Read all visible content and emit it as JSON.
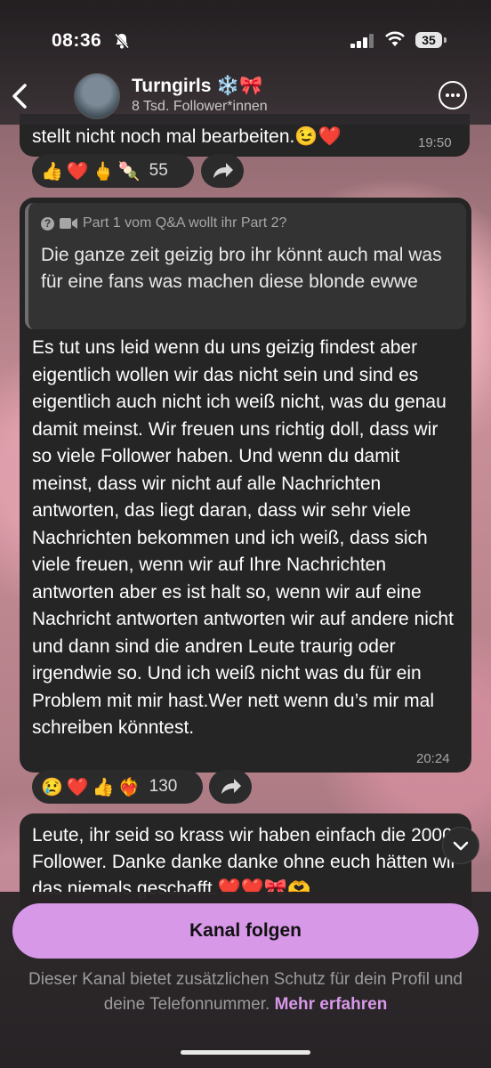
{
  "status_bar": {
    "time": "08:36",
    "battery": "35"
  },
  "header": {
    "channel_name": "Turngirls ❄️🎀",
    "followers": "8 Tsd. Follower*innen",
    "back_icon": "chevron-left-icon",
    "more_icon": "ellipsis-circle-icon"
  },
  "messages": [
    {
      "text": "stellt nicht noch mal bearbeiten.😉❤️",
      "time": "19:50",
      "reactions": [
        "👍",
        "❤️",
        "🖕",
        "🍡"
      ],
      "reaction_count": "55"
    },
    {
      "quote_header": "Part 1 vom Q&A wollt ihr Part 2?",
      "quote_text": "Die ganze zeit geizig bro ihr könnt auch mal was für eine fans was machen diese blonde ewwe",
      "text": "Es tut uns leid wenn du uns geizig findest aber eigentlich wollen wir das nicht sein und sind es eigentlich auch nicht ich weiß nicht, was du genau damit meinst. Wir freuen uns richtig doll, dass wir so viele Follower haben. Und wenn du damit meinst, dass wir nicht auf alle Nachrichten antworten, das liegt daran, dass wir sehr viele Nachrichten bekommen und ich weiß, dass sich viele freuen, wenn wir auf Ihre Nachrichten antworten aber es ist halt so, wenn wir auf eine Nachricht antworten antworten wir auf andere nicht und dann sind die andren Leute traurig oder irgendwie so. Und ich weiß nicht was du für ein Problem mit mir hast.Wer nett wenn du’s mir mal schreiben könntest.",
      "time": "20:24",
      "reactions": [
        "😢",
        "❤️",
        "👍",
        "❤️‍🔥"
      ],
      "reaction_count": "130"
    },
    {
      "text": "Leute, ihr seid so krass wir haben einfach die 2000 Follower. Danke danke danke ohne euch hätten wir das niemals geschafft.❤️❤️🎀🫶"
    }
  ],
  "bottom": {
    "follow_button": "Kanal folgen",
    "note": "Dieser Kanal bietet zusätzlichen Schutz für dein Profil und deine Telefonnummer.",
    "learn_more": "Mehr erfahren"
  },
  "colors": {
    "accent": "#d898e8",
    "bubble": "#252525"
  }
}
